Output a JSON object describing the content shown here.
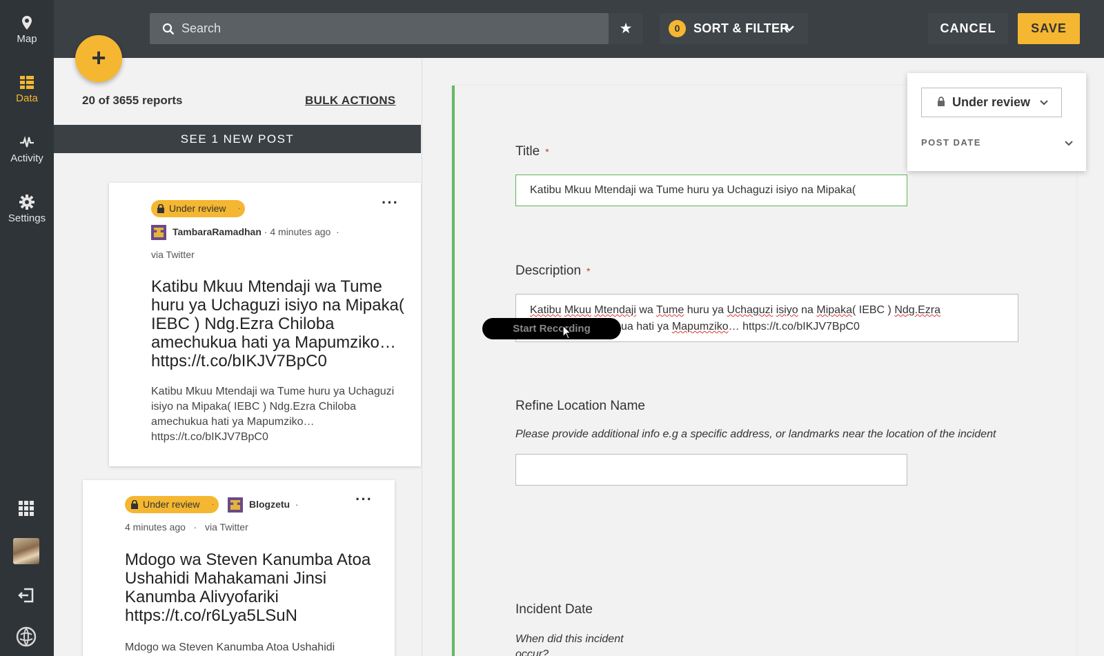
{
  "colors": {
    "accent": "#f5b731",
    "sidebar": "#2e3438",
    "topbar": "#3a4044",
    "focus_border": "#68b865"
  },
  "sidebar": {
    "items": [
      {
        "label": "Map",
        "icon": "map-pin-icon"
      },
      {
        "label": "Data",
        "icon": "data-list-icon",
        "active": true
      },
      {
        "label": "Activity",
        "icon": "activity-icon"
      },
      {
        "label": "Settings",
        "icon": "gear-icon"
      }
    ],
    "bottom_icons": [
      "apps-grid-icon",
      "user-avatar",
      "logout-icon",
      "ushahidi-logo-icon"
    ]
  },
  "topbar": {
    "search_placeholder": "Search",
    "sort_filter_label": "SORT & FILTER",
    "filter_count": "0",
    "cancel_label": "CANCEL",
    "save_label": "SAVE"
  },
  "list": {
    "count_text": "20 of 3655 reports",
    "bulk_actions": "BULK ACTIONS",
    "new_post_banner": "SEE 1 NEW POST",
    "posts": [
      {
        "status": "Under review",
        "author": "TambaraRamadhan",
        "time": "4 minutes ago",
        "source": "via Twitter",
        "title": "Katibu Mkuu Mtendaji wa Tume huru ya Uchaguzi isiyo na Mipaka( IEBC ) Ndg.Ezra Chiloba amechukua hati ya Mapumziko… https://t.co/bIKJV7BpC0",
        "body": "Katibu Mkuu Mtendaji wa Tume huru ya Uchaguzi isiyo na Mipaka( IEBC ) Ndg.Ezra Chiloba amechukua hati ya Mapumziko… https://t.co/bIKJV7BpC0"
      },
      {
        "status": "Under review",
        "author": "Blogzetu",
        "time": "4 minutes ago",
        "source": "via Twitter",
        "title": "Mdogo wa Steven Kanumba Atoa Ushahidi Mahakamani Jinsi Kanumba Alivyofariki https://t.co/r6Lya5LSuN",
        "body": "Mdogo wa Steven Kanumba Atoa Ushahidi"
      }
    ]
  },
  "form": {
    "title_label": "Title",
    "title_value": "Katibu Mkuu Mtendaji wa Tume huru ya  Uchaguzi isiyo na Mipaka(",
    "description_label": "Description",
    "description_line1_parts": [
      "Katibu",
      " ",
      "Mkuu",
      " ",
      "Mtendaji",
      " wa ",
      "Tume",
      " huru ya  ",
      "Uchaguzi",
      " ",
      "isiyo",
      " na ",
      "Mipaka",
      "( IEBC ) ",
      "Ndg.Ezra"
    ],
    "description_line2_visible": "ua hati ya ",
    "description_line2_squiggle": "Mapumziko",
    "description_line2_tail": "… https://t.co/bIKJV7BpC0",
    "location_label": "Refine Location Name",
    "location_helper": "Please provide additional info e.g a specific address, or landmarks near the location of the incident",
    "location_value": "",
    "incident_date_label": "Incident Date",
    "incident_date_helper": "When did this incident occur?",
    "required_mark": "*",
    "recording_label": "Start Recording"
  },
  "status_panel": {
    "selected": "Under review",
    "post_date_label": "POST DATE"
  }
}
